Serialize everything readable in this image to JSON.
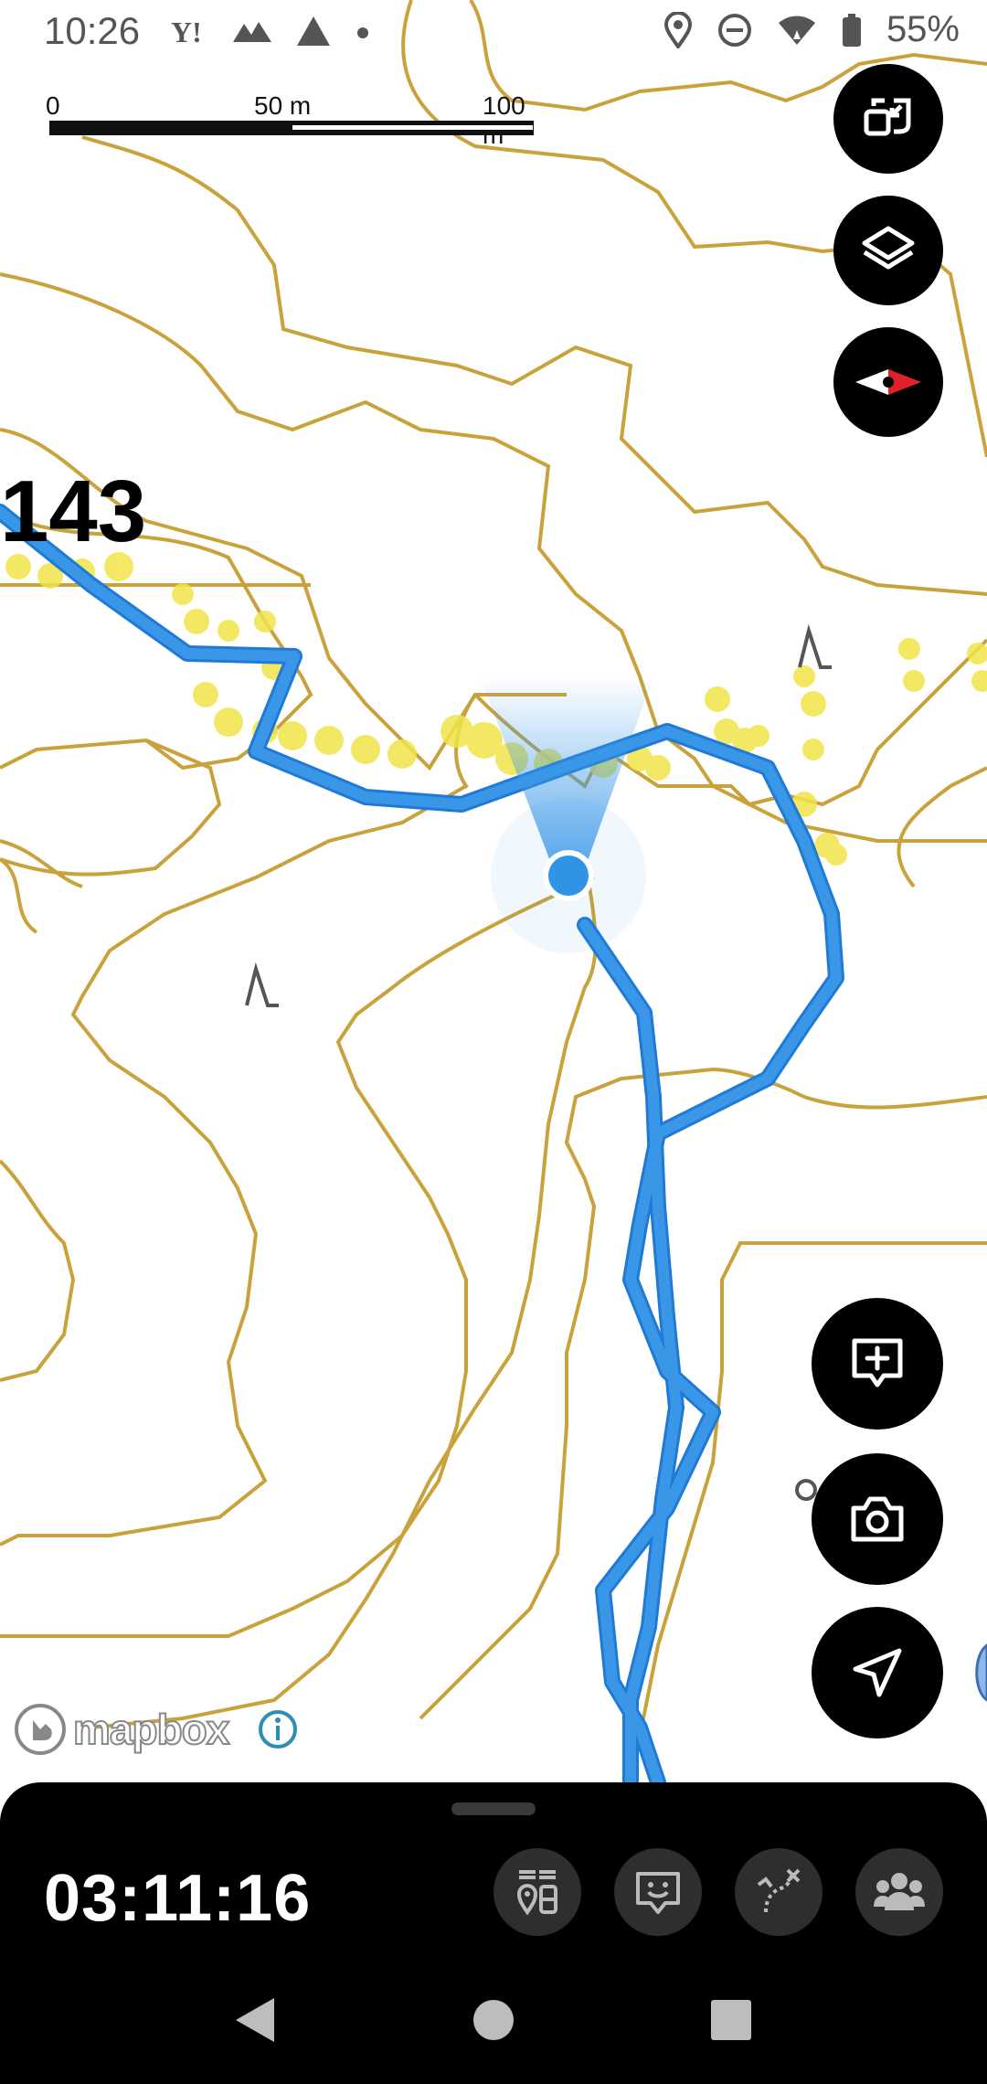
{
  "status_bar": {
    "time": "10:26",
    "battery": "55%",
    "icons": [
      "yahoo-icon",
      "mountains-icon",
      "tent-icon",
      "dot-icon",
      "location-icon",
      "dnd-icon",
      "wifi-icon",
      "battery-icon"
    ]
  },
  "scale_bar": {
    "label_0": "0",
    "label_mid": "50 m",
    "label_max": "100 m"
  },
  "map": {
    "elevation_label": "143",
    "attribution": "mapbox",
    "colors": {
      "contour": "#c9a23c",
      "track": "#3a97e8",
      "track_outline": "#1f7ad6",
      "trail_highlight": "#f2e44a",
      "location_dot": "#2f93e6"
    }
  },
  "right_controls": {
    "top": [
      "resize-icon",
      "layers-icon",
      "compass-icon"
    ],
    "bottom": [
      "add-note-icon",
      "camera-icon",
      "navigate-icon"
    ]
  },
  "bottom_sheet": {
    "timer": "03:11:16",
    "buttons": [
      "waypoints-icon",
      "face-icon",
      "route-icon",
      "group-icon"
    ]
  },
  "nav_bar": [
    "back-icon",
    "home-icon",
    "recents-icon"
  ]
}
